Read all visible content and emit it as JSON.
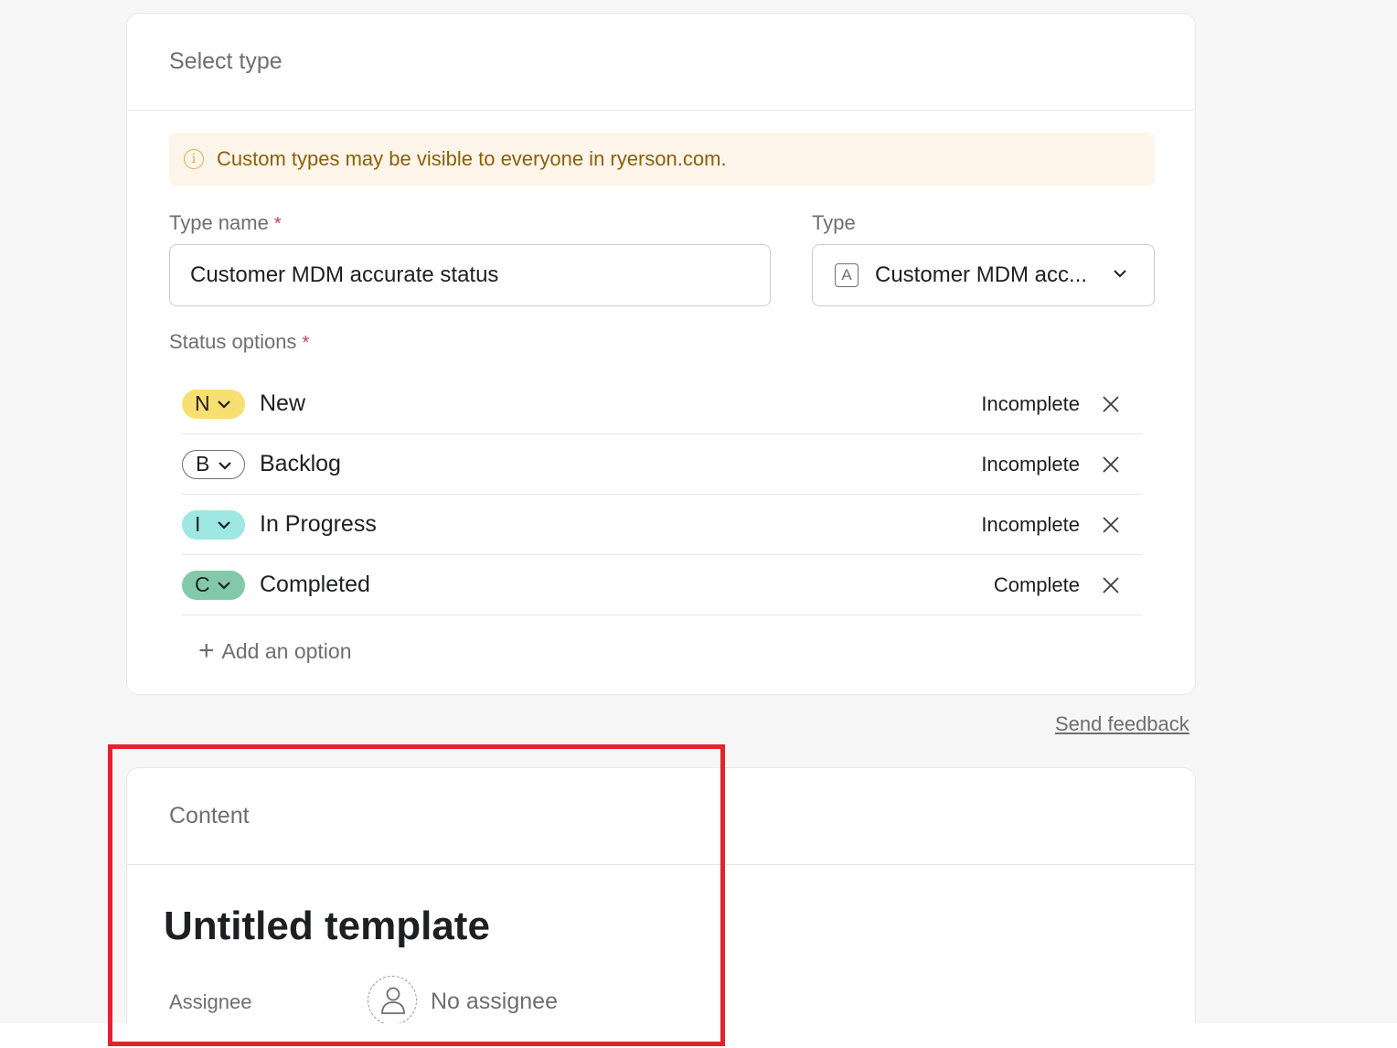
{
  "select_type": {
    "header": "Select type",
    "notice": "Custom types may be visible to everyone in ryerson.com.",
    "type_name_label": "Type name",
    "type_name_value": "Customer MDM accurate status",
    "type_label": "Type",
    "type_value": "Customer MDM acc...",
    "required_mark": "*",
    "status_options_label": "Status options",
    "statuses": [
      {
        "letter": "N",
        "name": "New",
        "state": "Incomplete",
        "color": "#f8df72"
      },
      {
        "letter": "B",
        "name": "Backlog",
        "state": "Incomplete",
        "color": "#ffffff"
      },
      {
        "letter": "I",
        "name": "In Progress",
        "state": "Incomplete",
        "color": "#9ee7e3"
      },
      {
        "letter": "C",
        "name": "Completed",
        "state": "Complete",
        "color": "#83c9a9"
      }
    ],
    "add_option": "Add an option"
  },
  "feedback_link": "Send feedback",
  "content": {
    "header": "Content",
    "title": "Untitled template",
    "assignee_label": "Assignee",
    "assignee_value": "No assignee"
  },
  "highlight_color": "#e3232b"
}
